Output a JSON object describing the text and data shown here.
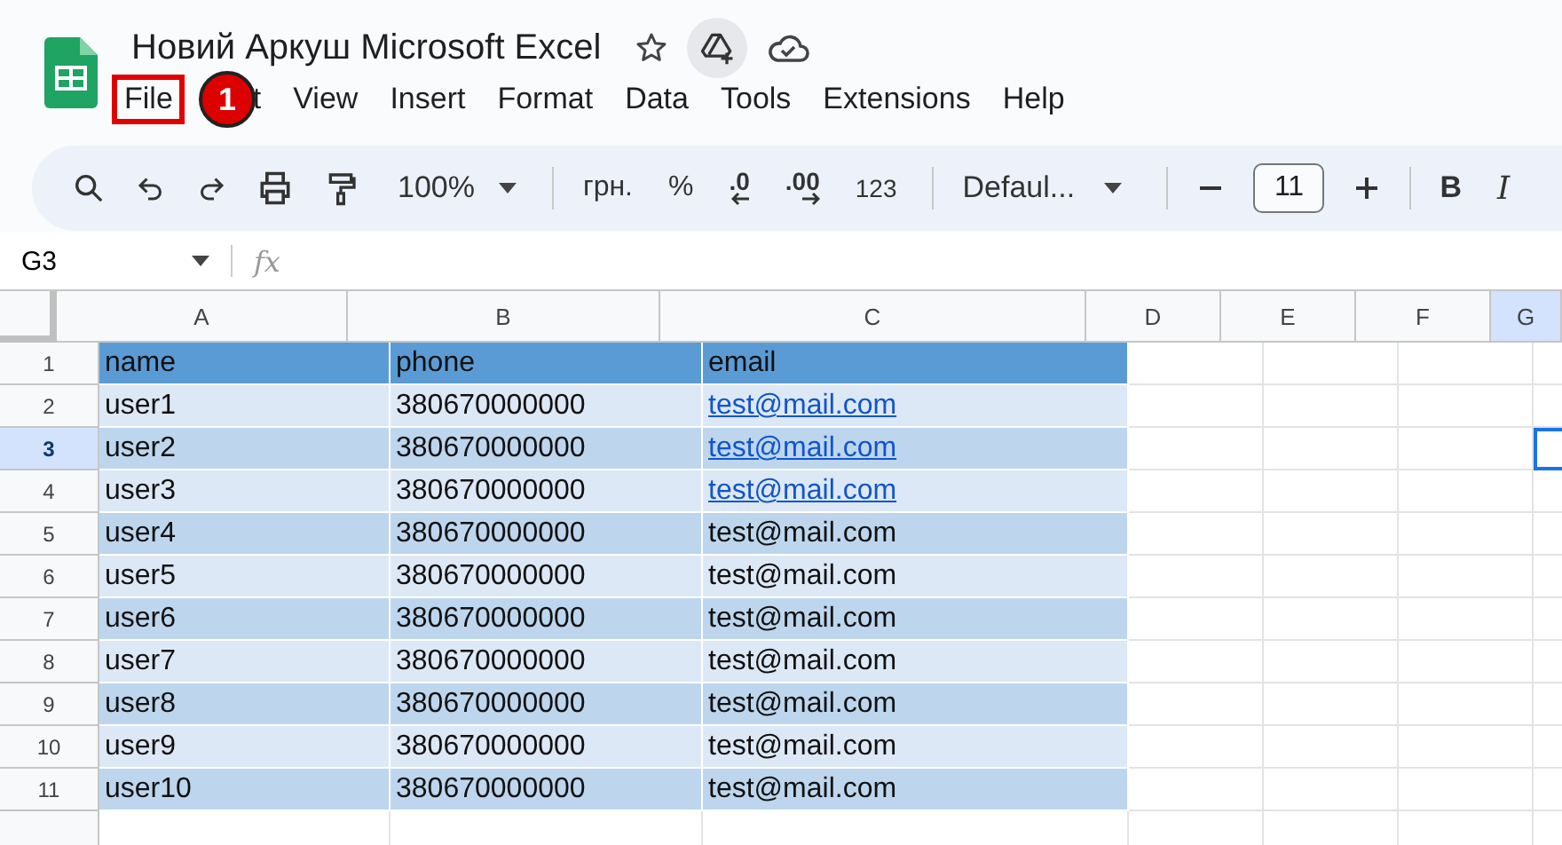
{
  "document": {
    "title": "Новий Аркуш Microsoft Excel"
  },
  "menu": [
    {
      "label": "File",
      "highlighted": true,
      "badge": "1"
    },
    {
      "label": "t",
      "highlighted": false
    },
    {
      "label": "View",
      "highlighted": false
    },
    {
      "label": "Insert",
      "highlighted": false
    },
    {
      "label": "Format",
      "highlighted": false
    },
    {
      "label": "Data",
      "highlighted": false
    },
    {
      "label": "Tools",
      "highlighted": false
    },
    {
      "label": "Extensions",
      "highlighted": false
    },
    {
      "label": "Help",
      "highlighted": false
    }
  ],
  "toolbar": {
    "zoom": "100%",
    "currency": "грн.",
    "percent": "%",
    "decrease_decimal": ".0",
    "increase_decimal": ".00",
    "number_format": "123",
    "font": "Defaul...",
    "font_size": "11",
    "bold": "B",
    "italic": "I"
  },
  "name_box": "G3",
  "formula_label": "fx",
  "columns": [
    {
      "label": "A",
      "selected": false
    },
    {
      "label": "B",
      "selected": false
    },
    {
      "label": "C",
      "selected": false
    },
    {
      "label": "D",
      "selected": false
    },
    {
      "label": "E",
      "selected": false
    },
    {
      "label": "F",
      "selected": false
    },
    {
      "label": "G",
      "selected": true
    }
  ],
  "rows": [
    {
      "number": "1",
      "selected": false,
      "kind": "header",
      "cells": [
        {
          "text": "name",
          "link": false
        },
        {
          "text": "phone",
          "link": false
        },
        {
          "text": "email",
          "link": false
        }
      ]
    },
    {
      "number": "2",
      "selected": false,
      "kind": "data",
      "cells": [
        {
          "text": "user1",
          "link": false
        },
        {
          "text": "380670000000",
          "link": false
        },
        {
          "text": "test@mail.com",
          "link": true
        }
      ]
    },
    {
      "number": "3",
      "selected": true,
      "kind": "data",
      "cells": [
        {
          "text": "user2",
          "link": false
        },
        {
          "text": "380670000000",
          "link": false
        },
        {
          "text": "test@mail.com",
          "link": true
        }
      ]
    },
    {
      "number": "4",
      "selected": false,
      "kind": "data",
      "cells": [
        {
          "text": "user3",
          "link": false
        },
        {
          "text": "380670000000",
          "link": false
        },
        {
          "text": "test@mail.com",
          "link": true
        }
      ]
    },
    {
      "number": "5",
      "selected": false,
      "kind": "data",
      "cells": [
        {
          "text": "user4",
          "link": false
        },
        {
          "text": "380670000000",
          "link": false
        },
        {
          "text": "test@mail.com",
          "link": false
        }
      ]
    },
    {
      "number": "6",
      "selected": false,
      "kind": "data",
      "cells": [
        {
          "text": "user5",
          "link": false
        },
        {
          "text": "380670000000",
          "link": false
        },
        {
          "text": "test@mail.com",
          "link": false
        }
      ]
    },
    {
      "number": "7",
      "selected": false,
      "kind": "data",
      "cells": [
        {
          "text": "user6",
          "link": false
        },
        {
          "text": "380670000000",
          "link": false
        },
        {
          "text": "test@mail.com",
          "link": false
        }
      ]
    },
    {
      "number": "8",
      "selected": false,
      "kind": "data",
      "cells": [
        {
          "text": "user7",
          "link": false
        },
        {
          "text": "380670000000",
          "link": false
        },
        {
          "text": "test@mail.com",
          "link": false
        }
      ]
    },
    {
      "number": "9",
      "selected": false,
      "kind": "data",
      "cells": [
        {
          "text": "user8",
          "link": false
        },
        {
          "text": "380670000000",
          "link": false
        },
        {
          "text": "test@mail.com",
          "link": false
        }
      ]
    },
    {
      "number": "10",
      "selected": false,
      "kind": "data",
      "cells": [
        {
          "text": "user9",
          "link": false
        },
        {
          "text": "380670000000",
          "link": false
        },
        {
          "text": "test@mail.com",
          "link": false
        }
      ]
    },
    {
      "number": "11",
      "selected": false,
      "kind": "data",
      "cells": [
        {
          "text": "user10",
          "link": false
        },
        {
          "text": "380670000000",
          "link": false
        },
        {
          "text": "test@mail.com",
          "link": false
        }
      ]
    }
  ]
}
